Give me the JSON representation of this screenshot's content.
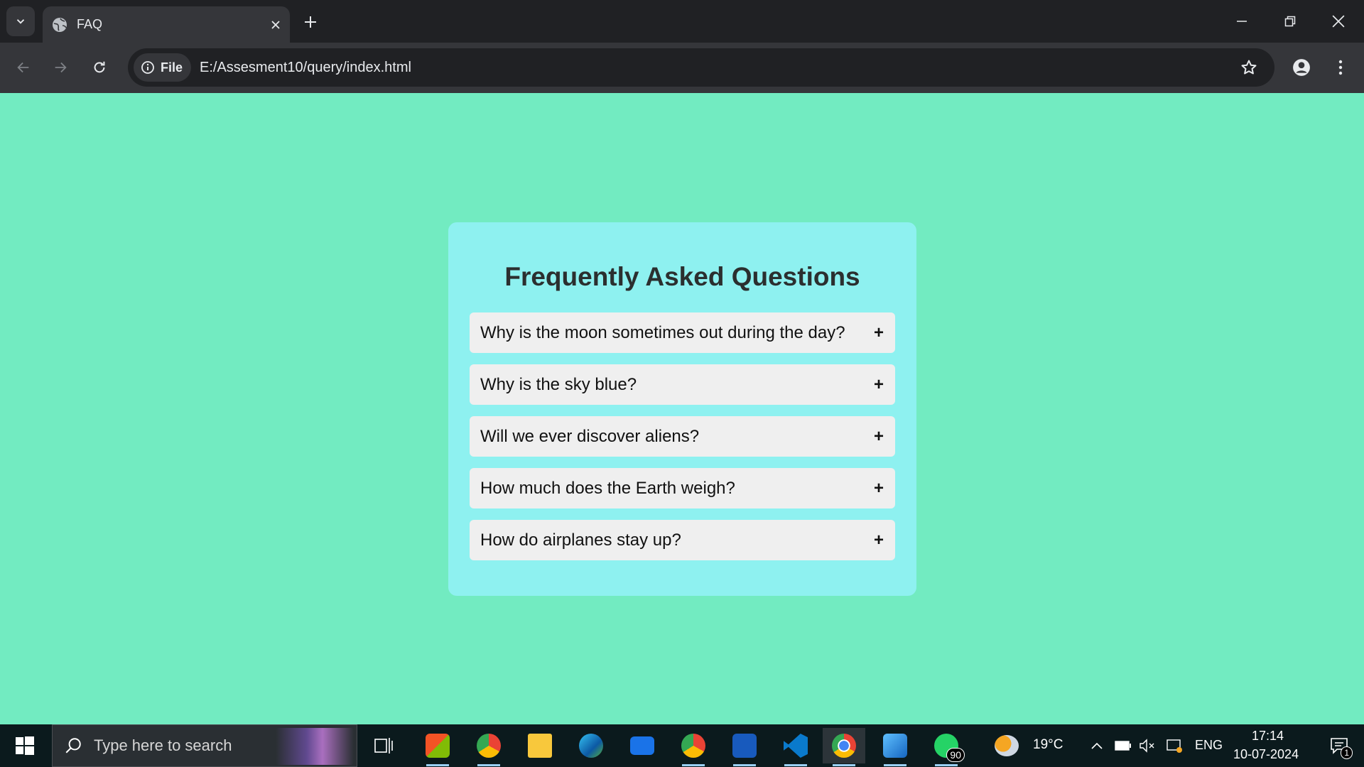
{
  "browser": {
    "tab_title": "FAQ",
    "url_chip": "File",
    "url": "E:/Assesment10/query/index.html"
  },
  "page": {
    "heading": "Frequently Asked Questions",
    "faqs": [
      {
        "question": "Why is the moon sometimes out during the day?",
        "toggle": "+"
      },
      {
        "question": "Why is the sky blue?",
        "toggle": "+"
      },
      {
        "question": "Will we ever discover aliens?",
        "toggle": "+"
      },
      {
        "question": "How much does the Earth weigh?",
        "toggle": "+"
      },
      {
        "question": "How do airplanes stay up?",
        "toggle": "+"
      }
    ],
    "colors": {
      "page_bg": "#72ebc1",
      "card_bg": "#8ef1f0",
      "item_bg": "#efefef"
    }
  },
  "taskbar": {
    "search_placeholder": "Type here to search",
    "weather_temp": "19°C",
    "language": "ENG",
    "time": "17:14",
    "date": "10-07-2024",
    "whatsapp_badge": "90",
    "notification_badge": "1",
    "apps": [
      "windows-start-icon",
      "task-view-icon",
      "store-icon",
      "chrome-profile-icon",
      "file-explorer-icon",
      "edge-icon",
      "mail-icon",
      "chrome-profile2-icon",
      "word-icon",
      "vscode-icon",
      "chrome-icon",
      "photos-icon",
      "whatsapp-icon"
    ]
  }
}
